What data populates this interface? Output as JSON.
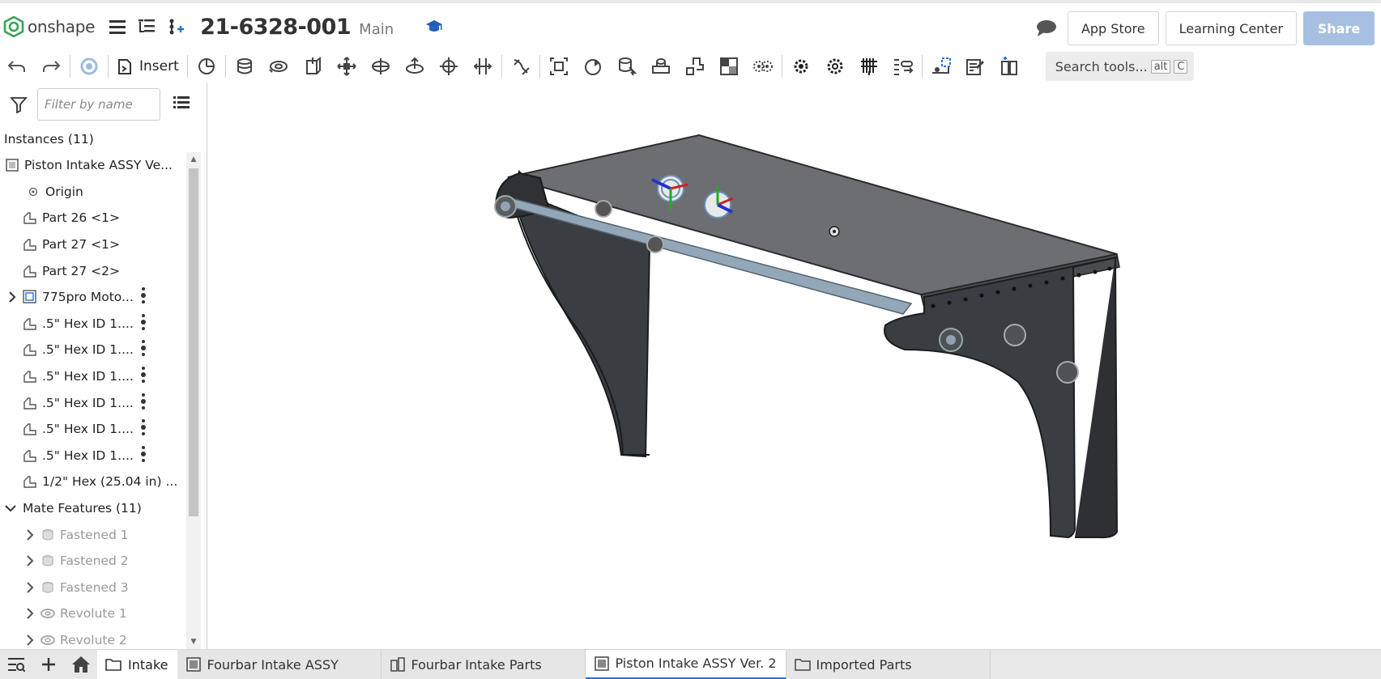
{
  "header": {
    "logo_text": "onshape",
    "doc_title": "21-6328-001",
    "branch": "Main",
    "app_store": "App Store",
    "learning_center": "Learning Center",
    "share": "Share"
  },
  "toolbar": {
    "insert_label": "Insert",
    "search_label": "Search tools...",
    "search_kbd_1": "alt",
    "search_kbd_2": "C"
  },
  "left_panel": {
    "filter_placeholder": "Filter by name",
    "instances_header": "Instances (11)",
    "instances": [
      {
        "label": "Piston Intake ASSY Ve..."
      },
      {
        "label": "Origin"
      },
      {
        "label": "Part 26 <1>"
      },
      {
        "label": "Part 27 <1>"
      },
      {
        "label": "Part 27 <2>"
      },
      {
        "label": "775pro Moto..."
      },
      {
        "label": ".5\" Hex ID 1...."
      },
      {
        "label": ".5\" Hex ID 1...."
      },
      {
        "label": ".5\" Hex ID 1...."
      },
      {
        "label": ".5\" Hex ID 1...."
      },
      {
        "label": ".5\" Hex ID 1...."
      },
      {
        "label": ".5\" Hex ID 1...."
      },
      {
        "label": "1/2\" Hex (25.04 in) ..."
      }
    ],
    "mates_header": "Mate Features (11)",
    "mates": [
      {
        "label": "Fastened 1"
      },
      {
        "label": "Fastened 2"
      },
      {
        "label": "Fastened 3"
      },
      {
        "label": "Revolute 1"
      },
      {
        "label": "Revolute 2"
      }
    ]
  },
  "bottom": {
    "crumb": "Intake",
    "tabs": [
      {
        "label": "Fourbar Intake ASSY"
      },
      {
        "label": "Fourbar Intake Parts"
      },
      {
        "label": "Piston Intake ASSY Ver. 2"
      },
      {
        "label": "Imported Parts"
      }
    ]
  },
  "colors": {
    "share_bg": "#a7c0e2",
    "active_tab_accent": "#2b6fd6",
    "model_dark": "#3a3d41",
    "model_top": "#6f7073",
    "rod": "#8fa3b4",
    "logo_green": "#3aa357"
  },
  "icons": {
    "header": [
      "onshape-logo",
      "menu-icon",
      "feature-list-icon",
      "version-graph-icon",
      "learning-cap-icon",
      "comment-icon"
    ],
    "toolbar": [
      "undo-icon",
      "redo-icon",
      "regen-icon",
      "insert-icon",
      "mate-connector-icon",
      "fastened-mate-icon",
      "revolute-mate-icon",
      "slider-mate-icon",
      "planar-mate-icon",
      "cylindrical-mate-icon",
      "pin-slot-mate-icon",
      "ball-mate-icon",
      "parallel-mate-icon",
      "tangent-mate-icon",
      "group-icon",
      "replicate-icon",
      "pattern-icon",
      "mirror-icon",
      "explode-icon",
      "named-positions-icon",
      "gear-relation-icon",
      "rack-pinion-icon",
      "screw-relation-icon",
      "linear-relation-icon",
      "measure-icon",
      "section-view-icon",
      "display-states-icon"
    ]
  }
}
